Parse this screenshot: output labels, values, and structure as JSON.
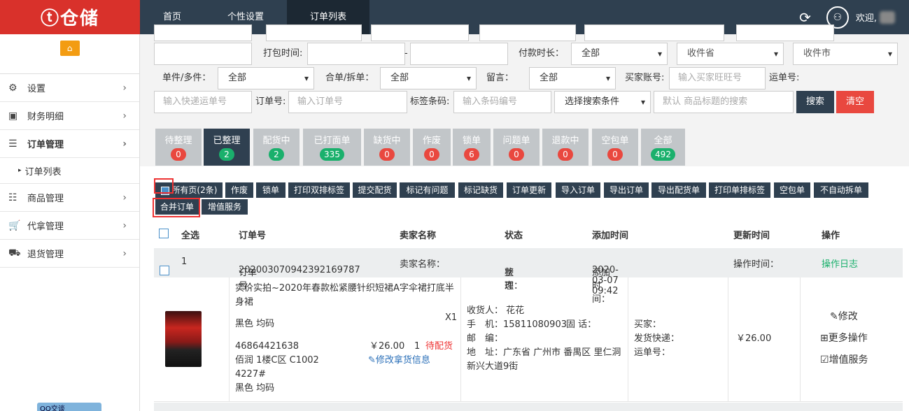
{
  "brand": {
    "logo": "ⓣ仓储"
  },
  "topnav": {
    "tabs": [
      "首页",
      "个性设置",
      "订单列表"
    ],
    "welcome": "欢迎,"
  },
  "sidebar": {
    "items": [
      {
        "label": "设置"
      },
      {
        "label": "财务明细"
      },
      {
        "label": "订单管理"
      },
      {
        "label": "订单列表"
      },
      {
        "label": "商品管理"
      },
      {
        "label": "代拿管理"
      },
      {
        "label": "退货管理"
      }
    ],
    "qq": "QQ交谈"
  },
  "filters": {
    "pack_time_label": "打包时间:",
    "dash": "-",
    "pay_duration_label": "付款时长：",
    "pay_duration": "全部",
    "province": "收件省",
    "city": "收件市",
    "single_multi_label": "单件/多件：",
    "single_multi": "全部",
    "merge_split_label": "合单/拆单：",
    "merge_split": "全部",
    "message_label": "留言：",
    "message": "全部",
    "buyer_label": "买家账号:",
    "buyer_ph": "输入买家旺旺号",
    "waybill_label": "运单号:",
    "waybill_ph": "输入快递运单号",
    "order_no_label": "订单号:",
    "order_no_ph": "输入订单号",
    "barcode_label": "标签条码:",
    "barcode_ph": "输入条码编号",
    "search_cond": "选择搜索条件",
    "keyword_ph": "默认 商品标题的搜索",
    "search_btn": "搜索",
    "clear_btn": "清空"
  },
  "status_tabs": [
    {
      "label": "待整理",
      "count": "0"
    },
    {
      "label": "已整理",
      "count": "2"
    },
    {
      "label": "配货中",
      "count": "2"
    },
    {
      "label": "已打面单",
      "count": "335"
    },
    {
      "label": "缺货中",
      "count": "0"
    },
    {
      "label": "作废",
      "count": "0"
    },
    {
      "label": "锁单",
      "count": "6"
    },
    {
      "label": "问题单",
      "count": "0"
    },
    {
      "label": "退款中",
      "count": "0"
    },
    {
      "label": "空包单",
      "count": "0"
    },
    {
      "label": "全部",
      "count": "492"
    }
  ],
  "actions": {
    "all_pages": "所有页(2条)",
    "buttons": [
      "作废",
      "锁单",
      "打印双排标签",
      "提交配货",
      "标记有问题",
      "标记缺货",
      "订单更新",
      "导入订单",
      "导出订单",
      "导出配货单",
      "打印单排标签",
      "空包单",
      "不自动拆单",
      "合并订单",
      "增值服务"
    ]
  },
  "table": {
    "headers": [
      "全选",
      "订单号",
      "卖家名称",
      "状态",
      "添加时间",
      "更新时间",
      "操作"
    ]
  },
  "order": {
    "index": "1",
    "order_no_label": "订单号：",
    "order_no": "202003070942392169787",
    "seller_label": "卖家名称：",
    "status_label": "状态：",
    "status": "整理",
    "add_time_label": "添加时间：",
    "add_time": "2020-03-07 09:42",
    "op_time_label": "操作时间：",
    "log": "操作日志",
    "title": "实价实拍~2020年春款松紧腰针织短裙A字伞裙打底半身裙",
    "spec": "黑色 均码",
    "qty": "X1",
    "sku": "46864421638",
    "price": "￥26.00",
    "count": "1",
    "pick_status": "待配货",
    "location": "佰润 1楼C区 C1002",
    "code": "4227#",
    "spec2": "黑色 均码",
    "edit_pick": "修改拿货信息",
    "receiver": "收货人： 花花",
    "phone": "手　机：15811080903",
    "tel": "固 话：",
    "zip": "邮　编：",
    "address": "地　址：广东省 广州市 番禺区 里仁洞新兴大道9街",
    "buyer": "买家：",
    "express": "发货快递：",
    "waybill": "运单号：",
    "amount": "￥26.00",
    "ops": [
      "修改",
      "更多操作",
      "增值服务"
    ]
  }
}
